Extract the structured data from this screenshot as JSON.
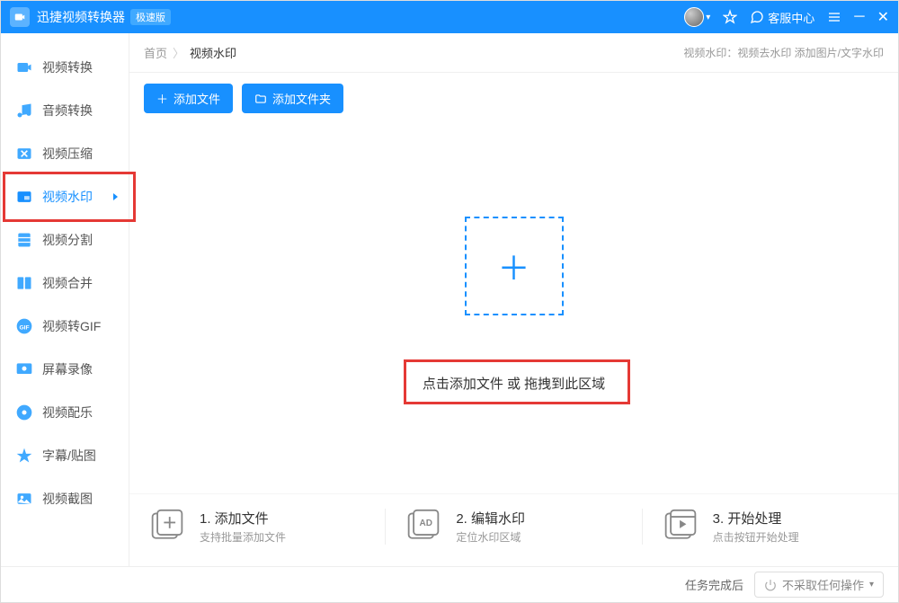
{
  "titlebar": {
    "app_title": "迅捷视频转换器",
    "version_badge": "极速版",
    "support_label": "客服中心"
  },
  "sidebar": {
    "items": [
      {
        "label": "视频转换"
      },
      {
        "label": "音频转换"
      },
      {
        "label": "视频压缩"
      },
      {
        "label": "视频水印"
      },
      {
        "label": "视频分割"
      },
      {
        "label": "视频合并"
      },
      {
        "label": "视频转GIF"
      },
      {
        "label": "屏幕录像"
      },
      {
        "label": "视频配乐"
      },
      {
        "label": "字幕/贴图"
      },
      {
        "label": "视频截图"
      }
    ]
  },
  "breadcrumb": {
    "home": "首页",
    "current": "视频水印",
    "description": "视频水印：视频去水印 添加图片/文字水印"
  },
  "actions": {
    "add_file": "添加文件",
    "add_folder": "添加文件夹"
  },
  "dropzone": {
    "text": "点击添加文件 或 拖拽到此区域"
  },
  "steps": [
    {
      "title": "1. 添加文件",
      "sub": "支持批量添加文件"
    },
    {
      "title": "2. 编辑水印",
      "sub": "定位水印区域"
    },
    {
      "title": "3. 开始处理",
      "sub": "点击按钮开始处理"
    }
  ],
  "footer": {
    "label": "任务完成后",
    "dropdown": "不采取任何操作"
  }
}
